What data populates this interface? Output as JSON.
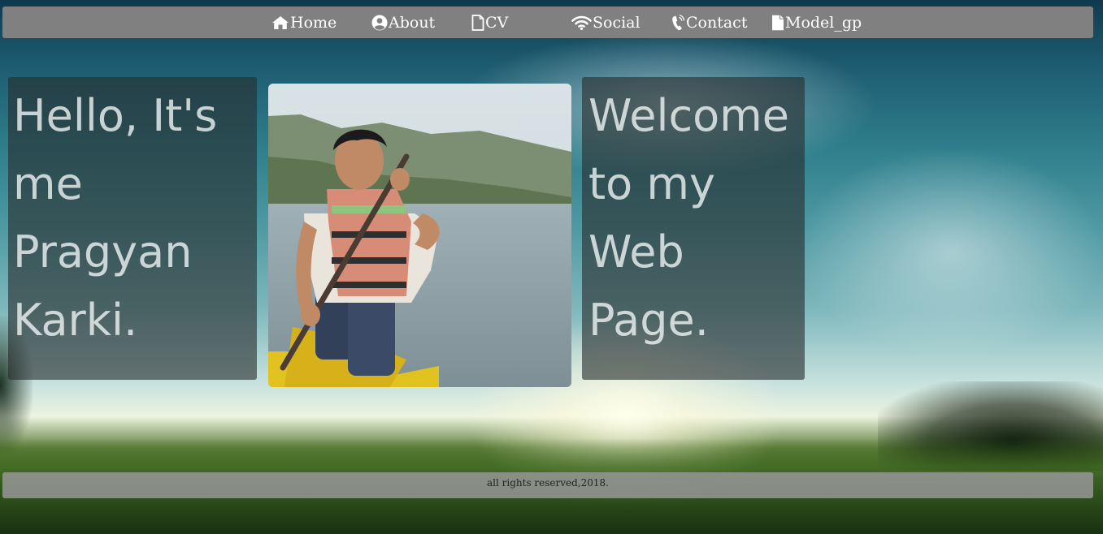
{
  "nav": {
    "items": [
      {
        "label": "Home",
        "icon": "home-icon"
      },
      {
        "label": "About",
        "icon": "user-circle-icon"
      },
      {
        "label": "CV",
        "icon": "file-outline-icon"
      },
      {
        "label": "Social",
        "icon": "wifi-icon"
      },
      {
        "label": "Contact",
        "icon": "phone-ringing-icon"
      },
      {
        "label": "Model_gp",
        "icon": "file-solid-icon"
      }
    ]
  },
  "intro": {
    "lines": [
      "Hello, It's",
      "me",
      "Pragyan",
      "Karki."
    ]
  },
  "welcome": {
    "lines": [
      "Welcome",
      "to my",
      "Web",
      "Page."
    ]
  },
  "footer": {
    "text": "all rights reserved,2018."
  },
  "colors": {
    "navbar": "#808080",
    "nav_text": "#ffffff",
    "panel": "#2d3232",
    "footer": "#969696"
  }
}
